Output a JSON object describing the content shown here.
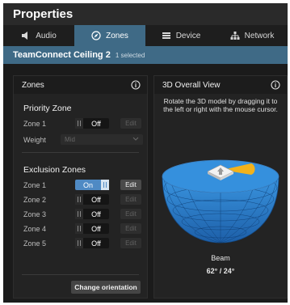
{
  "window": {
    "title": "Properties"
  },
  "tabs": [
    {
      "label": "Audio",
      "icon": "speaker-icon",
      "active": false
    },
    {
      "label": "Zones",
      "icon": "compass-icon",
      "active": true
    },
    {
      "label": "Device",
      "icon": "device-icon",
      "active": false
    },
    {
      "label": "Network",
      "icon": "network-icon",
      "active": false
    }
  ],
  "device": {
    "name": "TeamConnect Ceiling 2",
    "selection": "1 selected"
  },
  "zones_panel": {
    "title": "Zones",
    "priority": {
      "title": "Priority Zone",
      "zone_label": "Zone 1",
      "toggle": "Off",
      "edit": "Edit",
      "weight_label": "Weight",
      "weight_value": "Mid"
    },
    "exclusion": {
      "title": "Exclusion Zones",
      "zones": [
        {
          "label": "Zone 1",
          "state": "On",
          "edit": "Edit"
        },
        {
          "label": "Zone 2",
          "state": "Off",
          "edit": "Edit"
        },
        {
          "label": "Zone 3",
          "state": "Off",
          "edit": "Edit"
        },
        {
          "label": "Zone 4",
          "state": "Off",
          "edit": "Edit"
        },
        {
          "label": "Zone 5",
          "state": "Off",
          "edit": "Edit"
        }
      ]
    },
    "change_orientation": "Change orientation"
  },
  "view_panel": {
    "title": "3D Overall View",
    "hint": "Rotate the 3D model by dragging it to the left or right with the mouse cursor.",
    "beam_label": "Beam",
    "beam_value": "62° / 24°"
  },
  "colors": {
    "accent": "#3f6a86",
    "toggle_on": "#4f8ac4",
    "dome": "#2f86d6",
    "beam": "#f2b21c"
  }
}
